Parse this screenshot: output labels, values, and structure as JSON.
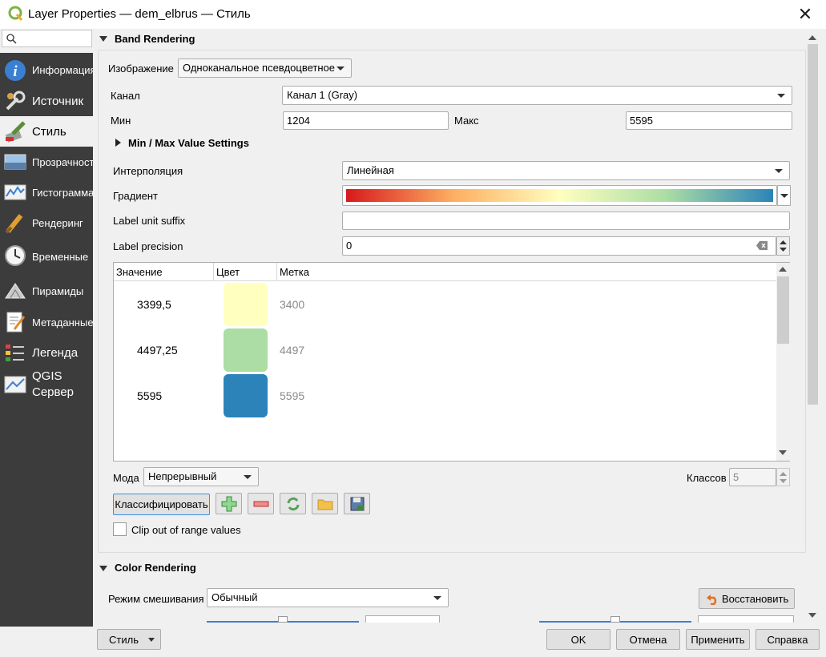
{
  "window": {
    "title": "Layer Properties — dem_elbrus — Стиль",
    "close_glyph": "✕"
  },
  "sidebar": {
    "search_placeholder": "",
    "items": [
      {
        "label": "Информация",
        "icon": "info-icon"
      },
      {
        "label": "Источник",
        "icon": "source-settings-icon"
      },
      {
        "label": "Стиль",
        "icon": "paintbrush-icon",
        "active": true
      },
      {
        "label": "Прозрачность",
        "icon": "transparency-icon"
      },
      {
        "label": "Гистограмма",
        "icon": "histogram-icon"
      },
      {
        "label": "Рендеринг",
        "icon": "rendering-brush-icon"
      },
      {
        "label": "Временные",
        "icon": "clock-icon"
      },
      {
        "label": "Пирамиды",
        "icon": "pyramids-icon"
      },
      {
        "label": "Метаданные",
        "icon": "metadata-icon"
      },
      {
        "label": "Легенда",
        "icon": "legend-icon"
      },
      {
        "label": "QGIS",
        "label2": "Сервер",
        "icon": "qgis-server-icon"
      }
    ]
  },
  "band": {
    "header": "Band Rendering",
    "image_label": "Изображение",
    "image_value": "Одноканальное псевдоцветное",
    "channel_label": "Канал",
    "channel_value": "Канал 1 (Gray)",
    "min_label": "Мин",
    "min_value": "1204",
    "max_label": "Макс",
    "max_value": "5595",
    "minmax_header": "Min / Max Value Settings",
    "interp_label": "Интерполяция",
    "interp_value": "Линейная",
    "gradient_label": "Градиент",
    "gradient_colors": [
      "#d7191c",
      "#fdae61",
      "#ffffbf",
      "#abdda4",
      "#2b83ba"
    ],
    "suffix_label": "Label unit suffix",
    "suffix_value": "",
    "precision_label": "Label precision",
    "precision_value": "0",
    "table": {
      "headers": [
        "Значение",
        "Цвет",
        "Метка"
      ],
      "rows": [
        {
          "value": "3399,5",
          "color": "#ffffbf",
          "label": "3400"
        },
        {
          "value": "4497,25",
          "color": "#abdda4",
          "label": "4497"
        },
        {
          "value": "5595",
          "color": "#2b83ba",
          "label": "5595"
        }
      ]
    },
    "mode_label": "Мода",
    "mode_value": "Непрерывный",
    "classes_label": "Классов",
    "classes_value": "5",
    "classify_label": "Классифицировать",
    "clip_label": "Clip out of range values"
  },
  "color_rendering": {
    "header": "Color Rendering",
    "blend_label": "Режим смешивания",
    "blend_value": "Обычный",
    "reset_label": "Восстановить"
  },
  "bottom": {
    "style_menu": "Стиль",
    "ok": "OK",
    "cancel": "Отмена",
    "apply": "Применить",
    "help": "Справка"
  }
}
